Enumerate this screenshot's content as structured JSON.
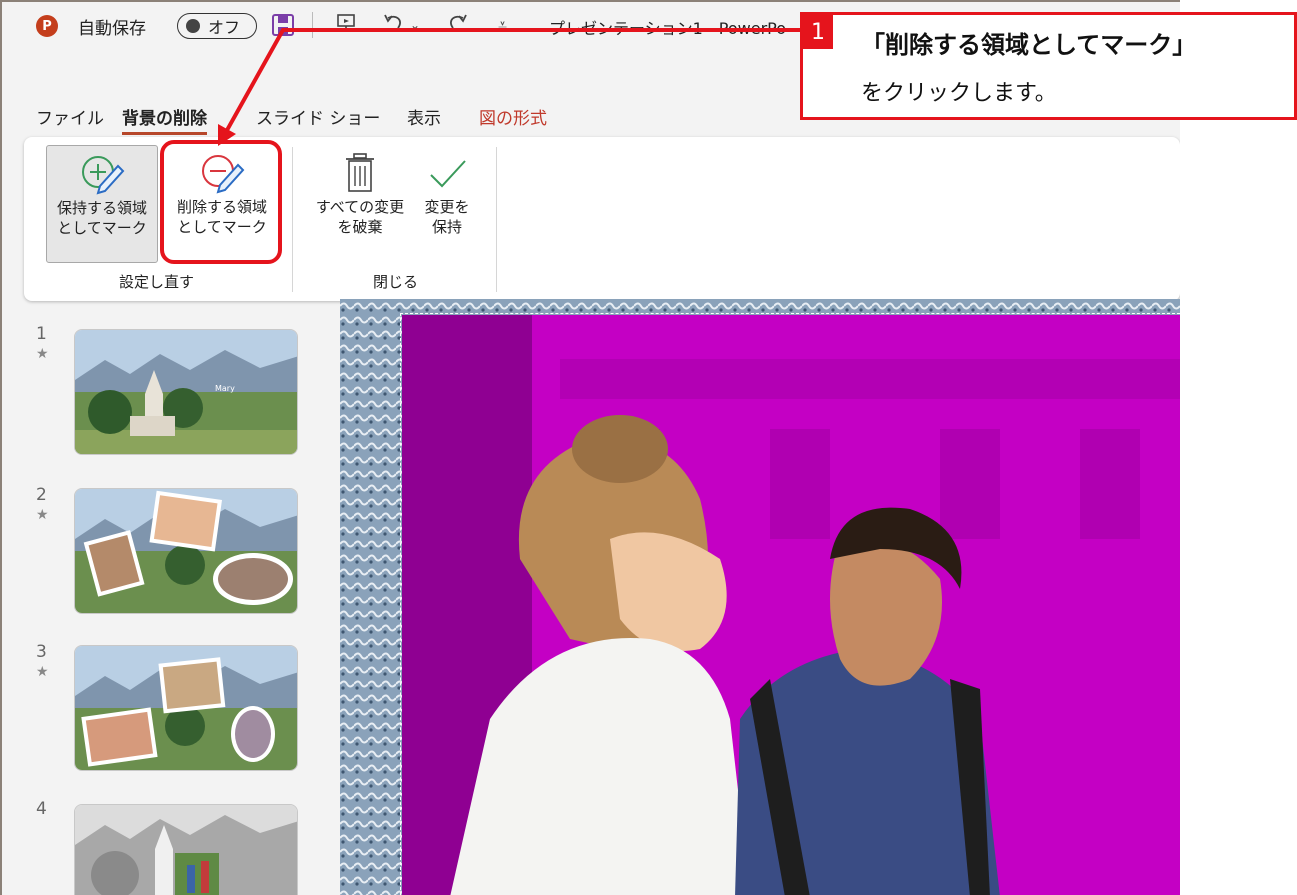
{
  "titlebar": {
    "app_icon": "powerpoint-logo",
    "autosave_label": "自動保存",
    "autosave_state": "オフ",
    "document_title": "プレゼンテーション1 - PowerPo"
  },
  "tabs": [
    {
      "label": "ファイル"
    },
    {
      "label": "背景の削除"
    },
    {
      "label": "スライド ショー"
    },
    {
      "label": "表示"
    },
    {
      "label": "図の形式"
    }
  ],
  "ribbon": {
    "groups": [
      {
        "label": "設定し直す",
        "buttons": [
          {
            "line1": "保持する領域",
            "line2": "としてマーク",
            "icon": "plus-pencil-icon"
          },
          {
            "line1": "削除する領域",
            "line2": "としてマーク",
            "icon": "minus-pencil-icon"
          }
        ]
      },
      {
        "label": "閉じる",
        "buttons": [
          {
            "line1": "すべての変更",
            "line2": "を破棄",
            "icon": "trash-icon"
          },
          {
            "line1": "変更を",
            "line2": "保持",
            "icon": "checkmark-icon"
          }
        ]
      }
    ]
  },
  "slides": [
    {
      "number": "1",
      "star": "★",
      "caption": "Mary"
    },
    {
      "number": "2",
      "star": "★"
    },
    {
      "number": "3",
      "star": "★"
    },
    {
      "number": "4"
    }
  ],
  "callout": {
    "step": "1",
    "line1": "「削除する領域としてマーク」",
    "line2": "をクリックします。"
  },
  "colors": {
    "accent": "#b7472a",
    "callout_red": "#e5141c",
    "removal_overlay": "#c400c4"
  }
}
